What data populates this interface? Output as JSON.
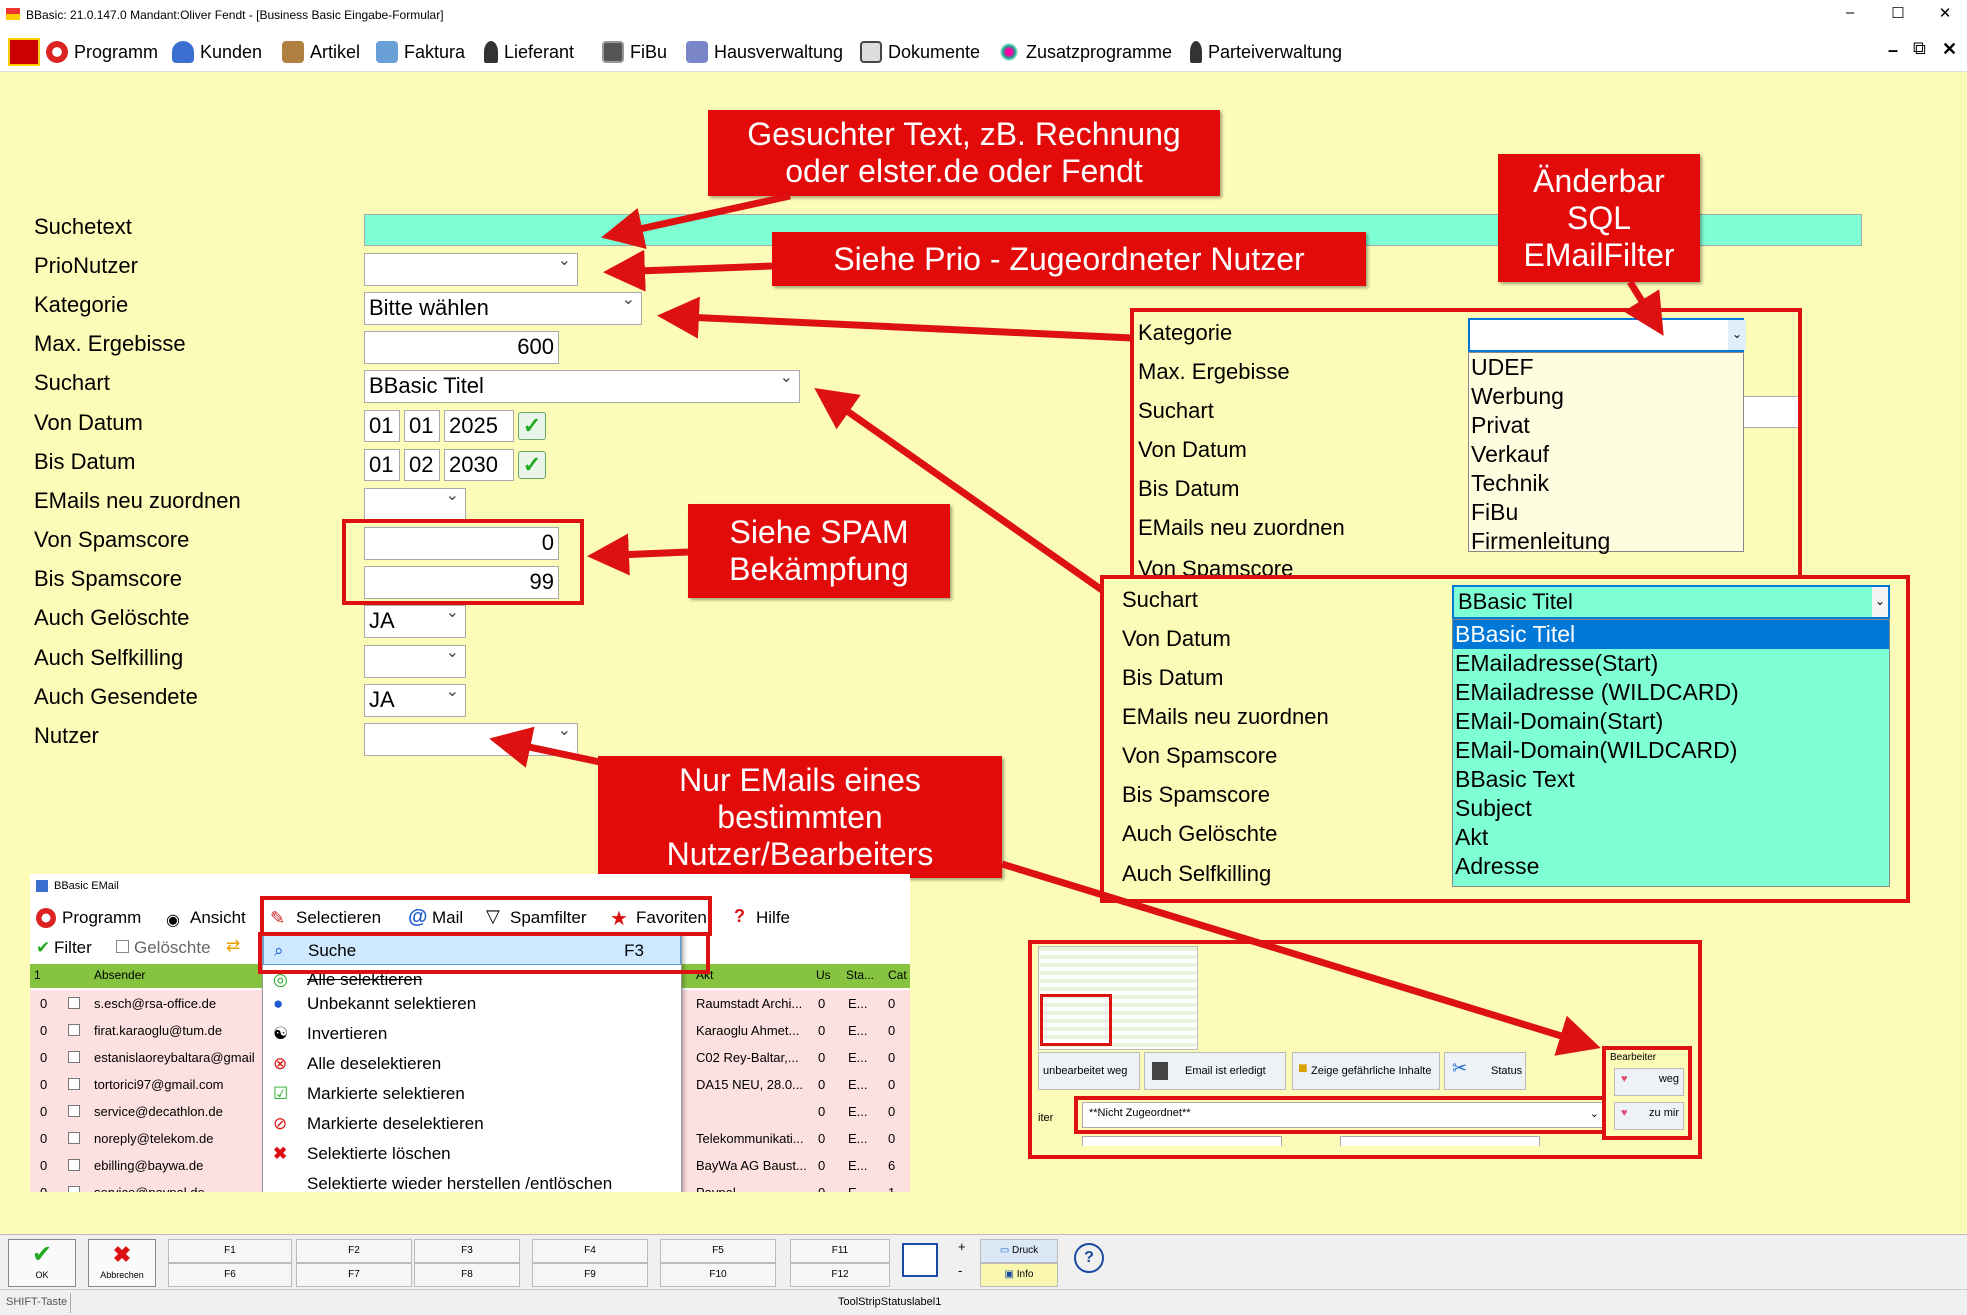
{
  "window": {
    "title": "BBasic: 21.0.147.0 Mandant:Oliver Fendt - [Business Basic Eingabe-Formular]",
    "controls": [
      "–",
      "☐",
      "✕"
    ]
  },
  "menubar": {
    "items": [
      "Programm",
      "Kunden",
      "Artikel",
      "Faktura",
      "Lieferant",
      "FiBu",
      "Hausverwaltung",
      "Dokumente",
      "Zusatzprogramme",
      "Parteiverwaltung"
    ],
    "right_controls": [
      "–",
      "⧉",
      "✕"
    ]
  },
  "form": {
    "labels": [
      "Suchetext",
      "PrioNutzer",
      "Kategorie",
      "Max. Ergebisse",
      "Suchart",
      "Von Datum",
      "Bis Datum",
      "EMails neu zuordnen",
      "Von Spamscore",
      "Bis Spamscore",
      "Auch Gelöschte",
      "Auch Selfkilling",
      "Auch Gesendete",
      "Nutzer"
    ],
    "suchetext": "",
    "prio_nutzer": "",
    "kategorie": "Bitte wählen",
    "max_ergebnisse": "600",
    "suchart": "BBasic Titel",
    "von_datum": {
      "day": "01",
      "month": "01",
      "year": "2025"
    },
    "bis_datum": {
      "day": "01",
      "month": "02",
      "year": "2030"
    },
    "emails_neu_zuordnen": "",
    "von_spamscore": "0",
    "bis_spamscore": "99",
    "auch_geloeschte": "JA",
    "auch_selfkilling": "",
    "auch_gesendete": "JA",
    "nutzer": ""
  },
  "callouts": {
    "suchtext": "Gesuchter Text, zB. Rechnung oder elster.de oder Fendt",
    "prio": "Siehe Prio - Zugeordneter Nutzer",
    "sql": "Änderbar SQL EMailFilter",
    "spam": "Siehe SPAM Bekämpfung",
    "nutzer": "Nur EMails eines bestimmten Nutzer/Bearbeiters"
  },
  "kategorie_panel": {
    "labels": [
      "Kategorie",
      "Max. Ergebisse",
      "Suchart",
      "Von Datum",
      "Bis Datum",
      "EMails neu zuordnen",
      "Von Spamscore"
    ],
    "options": [
      "UDEF",
      "Werbung",
      "Privat",
      "Verkauf",
      "Technik",
      "FiBu",
      "Firmenleitung"
    ]
  },
  "suchart_panel": {
    "labels": [
      "Suchart",
      "Von Datum",
      "Bis Datum",
      "EMails neu zuordnen",
      "Von Spamscore",
      "Bis Spamscore",
      "Auch Gelöschte",
      "Auch Selfkilling"
    ],
    "selected": "BBasic Titel",
    "options": [
      "BBasic Titel",
      "EMailadresse(Start)",
      "EMailadresse (WILDCARD)",
      "EMail-Domain(Start)",
      "EMail-Domain(WILDCARD)",
      "BBasic Text",
      "Subject",
      "Akt",
      "Adresse"
    ]
  },
  "email_window": {
    "title": "BBasic EMail",
    "menu": [
      "Programm",
      "Ansicht",
      "Selectieren",
      "Mail",
      "Spamfilter",
      "Favoriten",
      "Hilfe"
    ],
    "toolbar": {
      "filter": "Filter",
      "geloeschte": "Gelöschte"
    },
    "headers": [
      "1",
      "Absender",
      "Akt",
      "Us",
      "Sta...",
      "Cat"
    ],
    "rows": [
      {
        "n": "0",
        "sender": "s.esch@rsa-office.de",
        "akt": "Raumstadt Archi...",
        "us": "0",
        "sta": "E...",
        "cat": "0"
      },
      {
        "n": "0",
        "sender": "firat.karaoglu@tum.de",
        "akt": "Karaoglu Ahmet...",
        "us": "0",
        "sta": "E...",
        "cat": "0"
      },
      {
        "n": "0",
        "sender": "estanislaoreybaltara@gmail.c",
        "akt": "C02 Rey-Baltar,...",
        "us": "0",
        "sta": "E...",
        "cat": "0"
      },
      {
        "n": "0",
        "sender": "tortorici97@gmail.com",
        "akt": "DA15 NEU, 28.0...",
        "us": "0",
        "sta": "E...",
        "cat": "0"
      },
      {
        "n": "0",
        "sender": "service@decathlon.de",
        "akt": "",
        "us": "0",
        "sta": "E...",
        "cat": "0"
      },
      {
        "n": "0",
        "sender": "noreply@telekom.de",
        "akt": "Telekommunikati...",
        "us": "0",
        "sta": "E...",
        "cat": "0"
      },
      {
        "n": "0",
        "sender": "ebilling@baywa.de",
        "akt": "BayWa AG Baust...",
        "us": "0",
        "sta": "E...",
        "cat": "6"
      },
      {
        "n": "0",
        "sender": "service@paypal.de",
        "akt": "Paypal",
        "us": "0",
        "sta": "E...",
        "cat": "1"
      }
    ],
    "context_menu": {
      "items": [
        "Suche",
        "Alle selektieren",
        "Unbekannt selektieren",
        "Invertieren",
        "Alle deselektieren",
        "Markierte selektieren",
        "Markierte deselektieren",
        "Selektierte löschen",
        "Selektierte wieder herstellen /entlöschen"
      ],
      "shortcut": "F3"
    }
  },
  "thumbnail": {
    "buttons": [
      "unbearbeitet weg",
      "Email ist erledigt",
      "Zeige gefährliche Inhalte",
      "Status"
    ],
    "dropdown_prefix": "iter",
    "dropdown_value": "**Nicht Zugeordnet**",
    "bearbeiter_label": "Bearbeiter",
    "bearbeiter_buttons": [
      "weg",
      "zu mir"
    ]
  },
  "fkeys": {
    "ok": "OK",
    "cancel": "Abbrechen",
    "top": [
      "F1",
      "F2",
      "F3",
      "F4",
      "F5",
      "F11"
    ],
    "bottom": [
      "F6",
      "F7",
      "F8",
      "F9",
      "F10",
      "F12"
    ],
    "druck": "Druck",
    "info": "Info",
    "plus": "+",
    "minus": "-"
  },
  "statusbar": {
    "left": "SHIFT-Taste",
    "middle": "ToolStripStatuslabel1"
  },
  "colors": {
    "form_bg": "#fdfbb8",
    "callout_red": "#e30a0a",
    "suchetext_bg": "#7fffd4",
    "dropdown_highlight": "#0078d7"
  }
}
